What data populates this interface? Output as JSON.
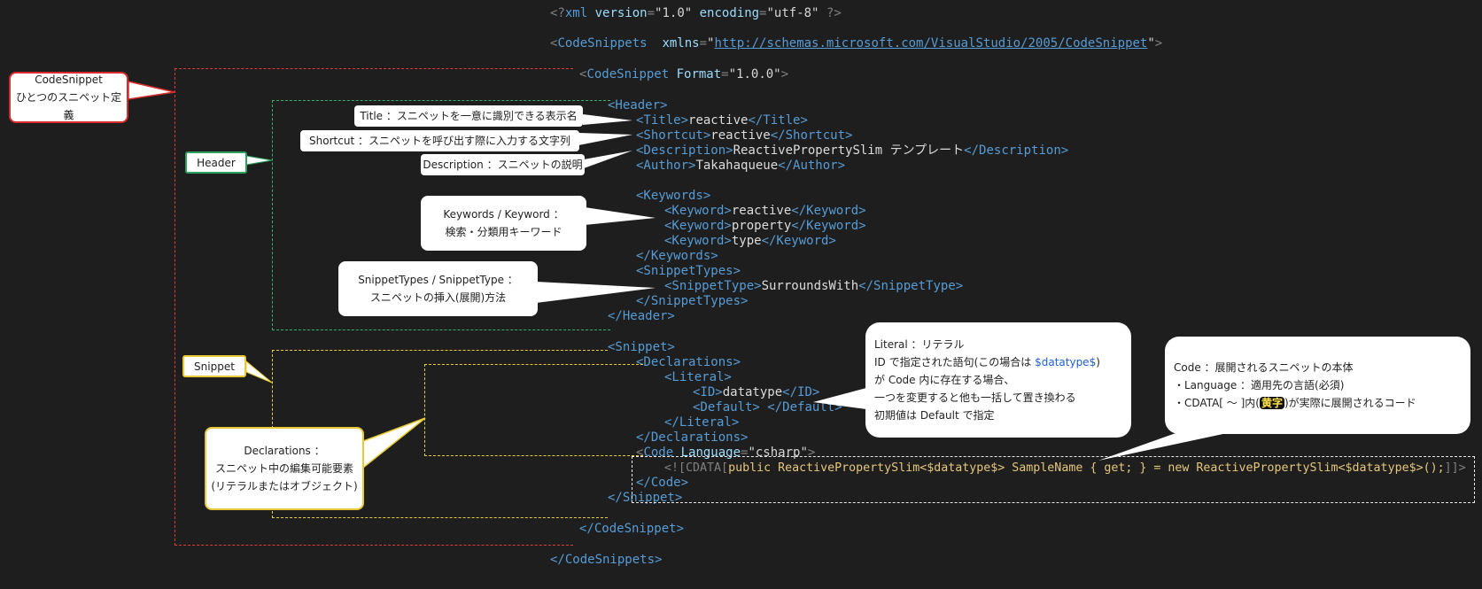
{
  "code": {
    "xml_decl": {
      "open": "<?",
      "name": "xml",
      "attr1": " version",
      "eq1": "=",
      "val1": "\"1.0\"",
      "attr2": " encoding",
      "eq2": "=",
      "val2": "\"utf-8\"",
      "close": " ?>"
    },
    "snippets_open": {
      "lt": "<",
      "name": "CodeSnippets",
      "attr": "  xmlns",
      "eq": "=",
      "q1": "\"",
      "url": "http://schemas.microsoft.com/VisualStudio/2005/CodeSnippet",
      "q2": "\"",
      "gt": ">"
    },
    "snippet_open": {
      "lt": "<",
      "name": "CodeSnippet",
      "attr": " Format",
      "eq": "=",
      "val": "\"1.0.0\"",
      "gt": ">"
    },
    "header_open": "<Header>",
    "title": {
      "open": "<Title>",
      "value": "reactive",
      "close": "</Title>"
    },
    "shortcut": {
      "open": "<Shortcut>",
      "value": "reactive",
      "close": "</Shortcut>"
    },
    "description": {
      "open": "<Description>",
      "value": "ReactivePropertySlim テンプレート",
      "close": "</Description>"
    },
    "author": {
      "open": "<Author>",
      "value": "Takahaqueue",
      "close": "</Author>"
    },
    "keywords_open": "<Keywords>",
    "keyword1": {
      "open": "<Keyword>",
      "value": "reactive",
      "close": "</Keyword>"
    },
    "keyword2": {
      "open": "<Keyword>",
      "value": "property",
      "close": "</Keyword>"
    },
    "keyword3": {
      "open": "<Keyword>",
      "value": "type",
      "close": "</Keyword>"
    },
    "keywords_close": "</Keywords>",
    "snippettypes_open": "<SnippetTypes>",
    "snippettype": {
      "open": "<SnippetType>",
      "value": "SurroundsWith",
      "close": "</SnippetType>"
    },
    "snippettypes_close": "</SnippetTypes>",
    "header_close": "</Header>",
    "snippet_tag_open": "<Snippet>",
    "declarations_open": "<Declarations>",
    "literal_open": "<Literal>",
    "id": {
      "open": "<ID>",
      "value": "datatype",
      "close": "</ID>"
    },
    "default": {
      "open": "<Default>",
      "value": " ",
      "close": "</Default>"
    },
    "literal_close": "</Literal>",
    "declarations_close": "</Declarations>",
    "code_open": {
      "lt": "<",
      "name": "Code",
      "attr": " Language",
      "eq": "=",
      "val": "\"csharp\"",
      "gt": ">"
    },
    "cdata": {
      "open": "<![CDATA[",
      "body": "public ReactivePropertySlim<$datatype$> SampleName { get; } = new ReactivePropertySlim<$datatype$>();",
      "close": "]]>"
    },
    "code_close": "</Code>",
    "snippet_tag_close": "</Snippet>",
    "snippet_close": "</CodeSnippet>",
    "snippets_close": "</CodeSnippets>"
  },
  "labels": {
    "codesnippet": {
      "line1": "CodeSnippet",
      "line2": "ひとつのスニペット定義"
    },
    "header": "Header",
    "snippet": "Snippet"
  },
  "callouts": {
    "title": "Title ：スニペットを一意に識別できる表示名",
    "shortcut": "Shortcut ：スニペットを呼び出す際に入力する文字列",
    "description": "Description ：スニペットの説明",
    "keywords": {
      "line1": "Keywords / Keyword ：",
      "line2": "検索・分類用キーワード"
    },
    "snippettypes": {
      "line1": "SnippetTypes / SnippetType ：",
      "line2": "スニペットの挿入(展開)方法"
    },
    "declarations": {
      "line1": "Declarations ：",
      "line2": "スニペット中の編集可能要素",
      "line3": "(リテラルまたはオブジェクト)"
    },
    "literal": {
      "line1": "Literal ：リテラル",
      "line2a": "ID で指定された語句(この場合は ",
      "line2b": "$datatype$",
      "line2c": ")",
      "line3": "が Code 内に存在する場合、",
      "line4": "一つを変更すると他も一括して置き換わる",
      "line5": "初期値は Default で指定"
    },
    "code": {
      "line1": "Code ：展開されるスニペットの本体",
      "line2": "・Language ：適用先の言語(必須)",
      "line3a": "・CDATA[ ～ ]内(",
      "line3b": "黄字",
      "line3c": ")が実際に展開されるコード"
    }
  },
  "colors": {
    "tag": "#569cd6",
    "attr": "#9cdcfe",
    "cdata_body": "#e6c77a",
    "red_box": "#e03a3a",
    "green_box": "#2fb36a",
    "yellow_box": "#e8cf2a"
  }
}
